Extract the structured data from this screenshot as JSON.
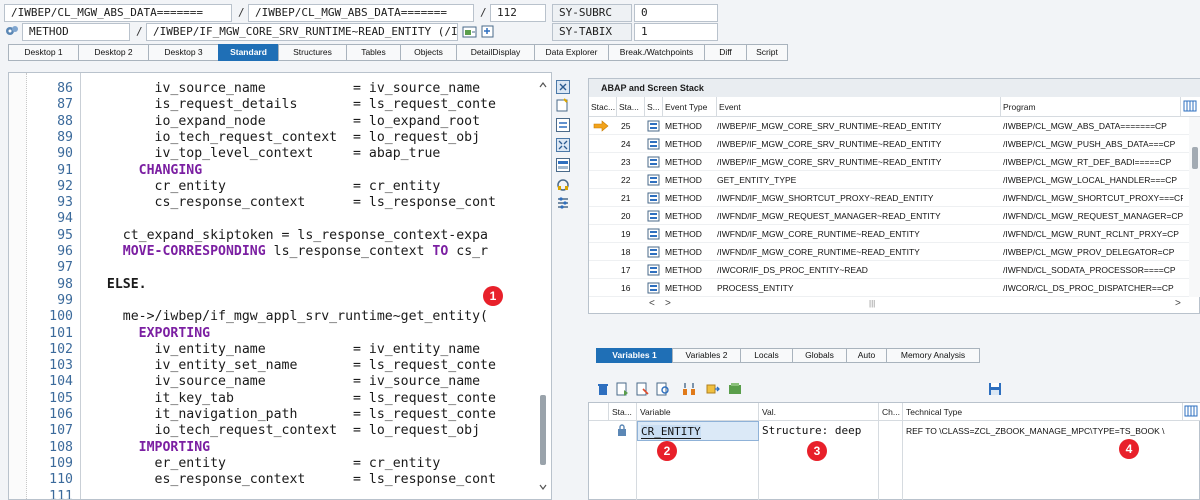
{
  "header": {
    "row1": {
      "program_field": "/IWBEP/CL_MGW_ABS_DATA=======",
      "include_field": "/IWBEP/CL_MGW_ABS_DATA=======",
      "line_field": "112",
      "sysvar1_name": "SY-SUBRC",
      "sysvar1_value": "0"
    },
    "row2": {
      "type_field": "METHOD",
      "event_field": "/IWBEP/IF_MGW_CORE_SRV_RUNTIME~READ_ENTITY (/IWBEP/CL_M...",
      "sysvar2_name": "SY-TABIX",
      "sysvar2_value": "1"
    },
    "separator": "/"
  },
  "tabs": [
    {
      "label": "Desktop 1",
      "active": false
    },
    {
      "label": "Desktop 2",
      "active": false
    },
    {
      "label": "Desktop 3",
      "active": false
    },
    {
      "label": "Standard",
      "active": true
    },
    {
      "label": "Structures",
      "active": false
    },
    {
      "label": "Tables",
      "active": false
    },
    {
      "label": "Objects",
      "active": false
    },
    {
      "label": "DetailDisplay",
      "active": false
    },
    {
      "label": "Data Explorer",
      "active": false
    },
    {
      "label": "Break./Watchpoints",
      "active": false
    },
    {
      "label": "Diff",
      "active": false
    },
    {
      "label": "Script",
      "active": false
    }
  ],
  "code": {
    "lines": [
      {
        "no": "86",
        "text": "        iv_source_name           = iv_source_name"
      },
      {
        "no": "87",
        "text": "        is_request_details       = ls_request_conte"
      },
      {
        "no": "88",
        "text": "        io_expand_node           = lo_expand_root"
      },
      {
        "no": "89",
        "text": "        io_tech_request_context  = lo_request_obj"
      },
      {
        "no": "90",
        "text": "        iv_top_level_context     = abap_true"
      },
      {
        "no": "91",
        "text": "      CHANGING",
        "kw": true
      },
      {
        "no": "92",
        "text": "        cr_entity                = cr_entity"
      },
      {
        "no": "93",
        "text": "        cs_response_context      = ls_response_cont"
      },
      {
        "no": "94",
        "text": ""
      },
      {
        "no": "95",
        "text": "    ct_expand_skiptoken = ls_response_context-expa"
      },
      {
        "no": "96",
        "text": "    MOVE-CORRESPONDING ls_response_context TO cs_r",
        "mixed": "move"
      },
      {
        "no": "97",
        "text": ""
      },
      {
        "no": "98",
        "text": "  ELSE.",
        "kwdark": true
      },
      {
        "no": "99",
        "text": ""
      },
      {
        "no": "100",
        "text": "    me->/iwbep/if_mgw_appl_srv_runtime~get_entity("
      },
      {
        "no": "101",
        "text": "      EXPORTING",
        "kw": true
      },
      {
        "no": "102",
        "text": "        iv_entity_name           = iv_entity_name"
      },
      {
        "no": "103",
        "text": "        iv_entity_set_name       = ls_request_conte"
      },
      {
        "no": "104",
        "text": "        iv_source_name           = iv_source_name"
      },
      {
        "no": "105",
        "text": "        it_key_tab               = ls_request_conte"
      },
      {
        "no": "106",
        "text": "        it_navigation_path       = ls_request_conte"
      },
      {
        "no": "107",
        "text": "        io_tech_request_context  = lo_request_obj"
      },
      {
        "no": "108",
        "text": "      IMPORTING",
        "kw": true
      },
      {
        "no": "109",
        "text": "        er_entity                = cr_entity"
      },
      {
        "no": "110",
        "text": "        es_response_context      = ls_response_cont"
      },
      {
        "no": "111",
        "text": ""
      }
    ]
  },
  "stack": {
    "title": "ABAP and Screen Stack",
    "headers": {
      "stack": "Stac...",
      "level": "Sta...",
      "s": "S...",
      "event_type": "Event Type",
      "event": "Event",
      "program": "Program"
    },
    "rows": [
      {
        "level": "25",
        "type": "METHOD",
        "event": "/IWBEP/IF_MGW_CORE_SRV_RUNTIME~READ_ENTITY",
        "program": "/IWBEP/CL_MGW_ABS_DATA=======CP",
        "current": true
      },
      {
        "level": "24",
        "type": "METHOD",
        "event": "/IWBEP/IF_MGW_CORE_SRV_RUNTIME~READ_ENTITY",
        "program": "/IWBEP/CL_MGW_PUSH_ABS_DATA===CP"
      },
      {
        "level": "23",
        "type": "METHOD",
        "event": "/IWBEP/IF_MGW_CORE_SRV_RUNTIME~READ_ENTITY",
        "program": "/IWBEP/CL_MGW_RT_DEF_BADI=====CP"
      },
      {
        "level": "22",
        "type": "METHOD",
        "event": "GET_ENTITY_TYPE",
        "program": "/IWBEP/CL_MGW_LOCAL_HANDLER===CP"
      },
      {
        "level": "21",
        "type": "METHOD",
        "event": "/IWFND/IF_MGW_SHORTCUT_PROXY~READ_ENTITY",
        "program": "/IWFND/CL_MGW_SHORTCUT_PROXY===CP"
      },
      {
        "level": "20",
        "type": "METHOD",
        "event": "/IWFND/IF_MGW_REQUEST_MANAGER~READ_ENTITY",
        "program": "/IWFND/CL_MGW_REQUEST_MANAGER=CP"
      },
      {
        "level": "19",
        "type": "METHOD",
        "event": "/IWFND/IF_MGW_CORE_RUNTIME~READ_ENTITY",
        "program": "/IWFND/CL_MGW_RUNT_RCLNT_PRXY=CP"
      },
      {
        "level": "18",
        "type": "METHOD",
        "event": "/IWFND/IF_MGW_CORE_RUNTIME~READ_ENTITY",
        "program": "/IWBEP/CL_MGW_PROV_DELEGATOR=CP"
      },
      {
        "level": "17",
        "type": "METHOD",
        "event": "/IWCOR/IF_DS_PROC_ENTITY~READ",
        "program": "/IWFND/CL_SODATA_PROCESSOR====CP"
      },
      {
        "level": "16",
        "type": "METHOD",
        "event": "PROCESS_ENTITY",
        "program": "/IWCOR/CL_DS_PROC_DISPATCHER==CP"
      }
    ],
    "scroll_left": "<",
    "scroll_right": ">",
    "scroll_mid": "|||"
  },
  "variables": {
    "tabs": [
      {
        "label": "Variables 1",
        "active": true
      },
      {
        "label": "Variables 2",
        "active": false
      },
      {
        "label": "Locals",
        "active": false
      },
      {
        "label": "Globals",
        "active": false
      },
      {
        "label": "Auto",
        "active": false
      },
      {
        "label": "Memory Analysis",
        "active": false
      }
    ],
    "headers": {
      "status": "Sta...",
      "variable": "Variable",
      "value": "Val.",
      "changed": "Ch...",
      "tech_type": "Technical Type"
    },
    "row": {
      "variable": "CR_ENTITY",
      "value": "Structure: deep",
      "tech_type": "REF TO \\CLASS=ZCL_ZBOOK_MANAGE_MPC\\TYPE=TS_BOOK  \\"
    }
  },
  "badges": [
    "1",
    "2",
    "3",
    "4"
  ],
  "colors": {
    "accent": "#1f6fb6",
    "keyword": "#7b1fa2",
    "badge": "#e8202a",
    "line_number": "#3b6a9b"
  }
}
